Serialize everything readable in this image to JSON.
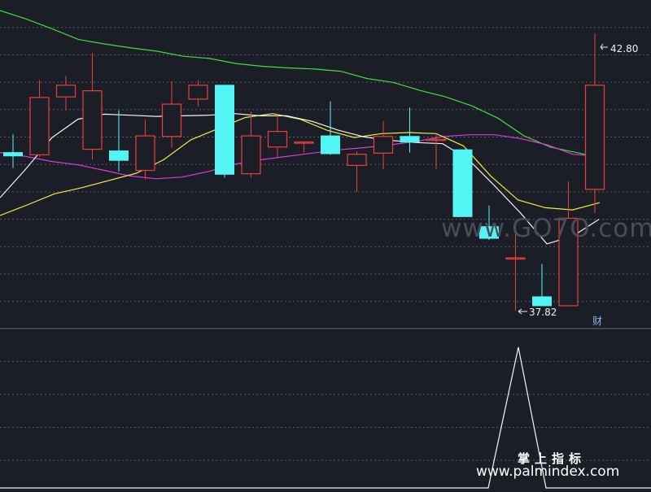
{
  "chart_data": {
    "type": "candlestick",
    "high_label": "42.80",
    "low_label": "37.82",
    "marker_label": "财",
    "ylim": [
      37.5,
      43.4
    ],
    "candles": [
      {
        "o": 40.66,
        "h": 40.99,
        "l": 40.38,
        "c": 40.6
      },
      {
        "o": 40.62,
        "h": 41.96,
        "l": 40.58,
        "c": 41.65
      },
      {
        "o": 41.66,
        "h": 42.04,
        "l": 41.42,
        "c": 41.87
      },
      {
        "o": 40.72,
        "h": 42.45,
        "l": 40.53,
        "c": 41.77
      },
      {
        "o": 40.69,
        "h": 41.42,
        "l": 40.32,
        "c": 40.52
      },
      {
        "o": 40.34,
        "h": 41.25,
        "l": 40.18,
        "c": 40.96
      },
      {
        "o": 40.95,
        "h": 41.94,
        "l": 40.75,
        "c": 41.53
      },
      {
        "o": 41.62,
        "h": 41.96,
        "l": 41.49,
        "c": 41.87
      },
      {
        "o": 41.87,
        "h": 41.87,
        "l": 40.21,
        "c": 40.27
      },
      {
        "o": 40.28,
        "h": 41.4,
        "l": 40.21,
        "c": 40.96
      },
      {
        "o": 40.76,
        "h": 41.36,
        "l": 40.58,
        "c": 41.04
      },
      {
        "o": 40.85,
        "h": 40.85,
        "l": 40.66,
        "c": 40.85
      },
      {
        "o": 40.96,
        "h": 41.58,
        "l": 40.62,
        "c": 40.64
      },
      {
        "o": 40.43,
        "h": 40.68,
        "l": 39.95,
        "c": 40.63
      },
      {
        "o": 40.65,
        "h": 41.23,
        "l": 40.36,
        "c": 40.95
      },
      {
        "o": 40.95,
        "h": 41.47,
        "l": 40.66,
        "c": 40.85
      },
      {
        "o": 40.88,
        "h": 40.98,
        "l": 40.36,
        "c": 40.9
      },
      {
        "o": 40.71,
        "h": 40.71,
        "l": 39.57,
        "c": 39.51
      },
      {
        "o": 39.33,
        "h": 39.71,
        "l": 39.09,
        "c": 39.12
      },
      {
        "o": 38.77,
        "h": 39.32,
        "l": 37.82,
        "c": 38.77
      },
      {
        "o": 38.07,
        "h": 38.66,
        "l": 37.91,
        "c": 37.91
      },
      {
        "o": 37.91,
        "h": 40.14,
        "l": 37.91,
        "c": 39.48
      },
      {
        "o": 40.0,
        "h": 42.8,
        "l": 39.57,
        "c": 41.87
      }
    ],
    "ma_white": [
      39.85,
      40.37,
      40.93,
      41.26,
      41.35,
      41.33,
      41.31,
      41.32,
      41.33,
      41.36,
      41.32,
      41.32,
      41.22,
      41.06,
      40.94,
      40.88,
      40.84,
      40.82,
      40.53,
      40.06,
      39.57,
      39.02,
      39.16,
      39.46
    ],
    "ma_yellow": [
      39.53,
      39.72,
      39.92,
      40.03,
      40.16,
      40.29,
      40.53,
      40.89,
      41.09,
      41.29,
      41.36,
      41.26,
      41.06,
      40.93,
      41.0,
      41.02,
      41.0,
      40.78,
      40.24,
      39.81,
      39.67,
      39.63,
      39.76
    ],
    "ma_magenta": [
      40.66,
      40.59,
      40.5,
      40.44,
      40.34,
      40.24,
      40.19,
      40.22,
      40.32,
      40.45,
      40.53,
      40.59,
      40.65,
      40.71,
      40.75,
      40.8,
      40.86,
      40.95,
      40.98,
      40.98,
      40.91,
      40.8,
      40.63,
      40.59
    ],
    "ma_green": [
      43.21,
      43.06,
      42.88,
      42.69,
      42.61,
      42.54,
      42.48,
      42.39,
      42.35,
      42.26,
      42.21,
      42.18,
      42.16,
      42.12,
      41.99,
      41.92,
      41.78,
      41.66,
      41.5,
      41.28,
      40.96,
      40.76,
      40.66,
      40.56
    ],
    "sub_series": [
      0,
      0,
      0,
      0,
      0,
      0,
      0,
      0,
      0,
      0,
      0,
      0,
      0,
      0,
      0,
      0,
      0,
      0.03,
      0.84,
      0.0,
      0,
      0,
      0,
      0
    ]
  },
  "colors": {
    "background": "#1b1e27",
    "up": "#e8413b",
    "down": "#52f4f4",
    "ma_white": "#f2f2f2",
    "ma_yellow": "#f0ee3a",
    "ma_magenta": "#d93bd6",
    "ma_green": "#3ce03a",
    "grid": "#5a5f6e",
    "label": "#f0f0f0",
    "marker": "#8fb4e8",
    "sub_line": "#f5f5f5"
  },
  "watermark": {
    "top_text": "www.GO7O.com",
    "cn_text": "掌上指标",
    "url_text": "www.palmindex.com"
  }
}
